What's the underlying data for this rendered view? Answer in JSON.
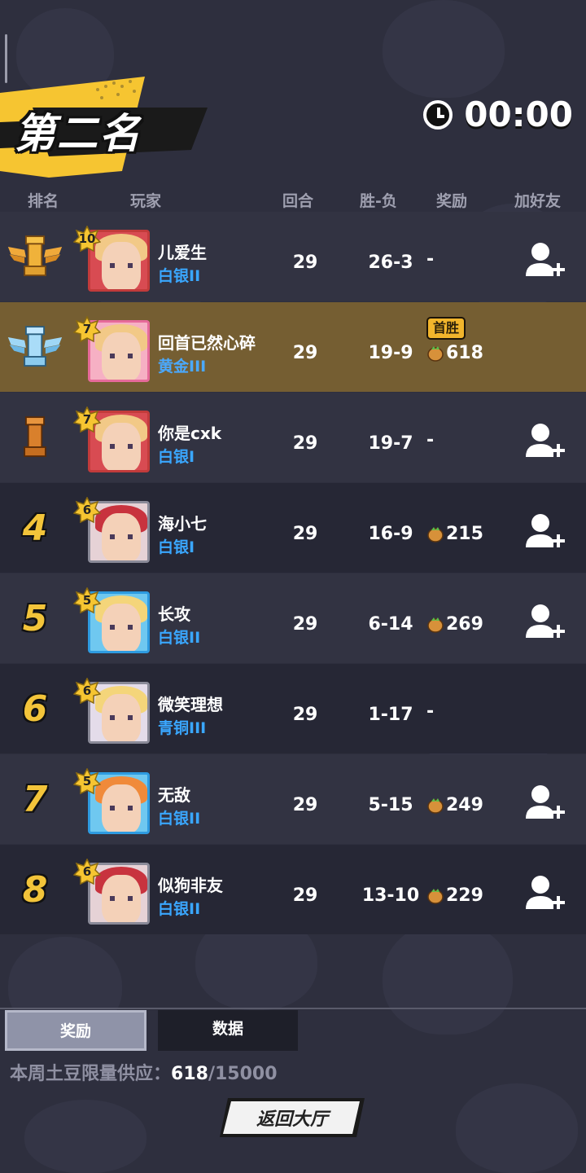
{
  "header": {
    "placement_title": "第二名",
    "timer": "00:00"
  },
  "columns": [
    "排名",
    "玩家",
    "回合",
    "胜-负",
    "奖励",
    "加好友"
  ],
  "rows": [
    {
      "rank": "1",
      "level": "10",
      "name": "儿爱生",
      "tier": "白银II",
      "rounds": "29",
      "wl": "26-3",
      "reward": "-",
      "first_win": "",
      "add_friend": true
    },
    {
      "rank": "2",
      "level": "7",
      "name": "回首已然心碎",
      "tier": "黄金III",
      "rounds": "29",
      "wl": "19-9",
      "reward": "618",
      "first_win": "首胜",
      "add_friend": false
    },
    {
      "rank": "3",
      "level": "7",
      "name": "你是cxk",
      "tier": "白银I",
      "rounds": "29",
      "wl": "19-7",
      "reward": "-",
      "first_win": "",
      "add_friend": true
    },
    {
      "rank": "4",
      "level": "6",
      "name": "海小七",
      "tier": "白银I",
      "rounds": "29",
      "wl": "16-9",
      "reward": "215",
      "first_win": "",
      "add_friend": true
    },
    {
      "rank": "5",
      "level": "5",
      "name": "长攻",
      "tier": "白银II",
      "rounds": "29",
      "wl": "6-14",
      "reward": "269",
      "first_win": "",
      "add_friend": true
    },
    {
      "rank": "6",
      "level": "6",
      "name": "微笑理想",
      "tier": "青铜III",
      "rounds": "29",
      "wl": "1-17",
      "reward": "-",
      "first_win": "",
      "add_friend": false
    },
    {
      "rank": "7",
      "level": "5",
      "name": "无敌",
      "tier": "白银II",
      "rounds": "29",
      "wl": "5-15",
      "reward": "249",
      "first_win": "",
      "add_friend": true
    },
    {
      "rank": "8",
      "level": "6",
      "name": "似狗非友",
      "tier": "白银II",
      "rounds": "29",
      "wl": "13-10",
      "reward": "229",
      "first_win": "",
      "add_friend": true
    }
  ],
  "tabs": {
    "reward": "奖励",
    "data": "数据"
  },
  "supply": {
    "label": "本周土豆限量供应：",
    "current": "618",
    "max": "/15000"
  },
  "back_button": "返回大厅",
  "colors": {
    "gold": "#f3c43a",
    "tier_blue": "#3aa7ff",
    "highlight_row": "#755e32"
  }
}
